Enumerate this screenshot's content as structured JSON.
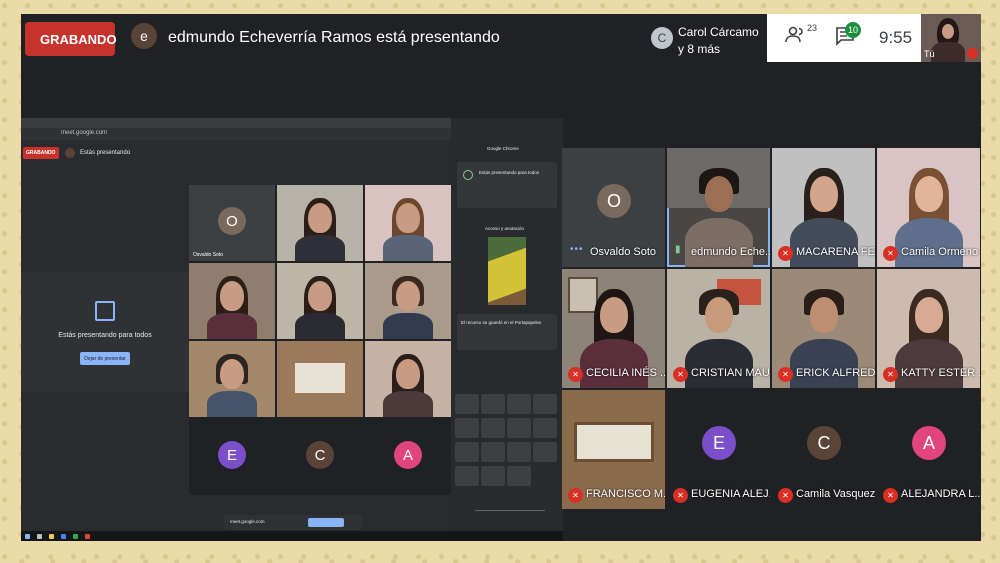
{
  "topbar": {
    "recording_label": "GRABANDO",
    "presenter_initial": "e",
    "presenter_text": "edmundo Echeverría Ramos está presentando",
    "people_summary_initial": "C",
    "people_summary_line1": "Carol Cárcamo",
    "people_summary_line2": "y 8 más",
    "participants_count": "23",
    "chat_count": "10",
    "clock": "9:55",
    "self_label": "Tú"
  },
  "shared_screen": {
    "recording_label": "GRABANDO",
    "presenting_label": "Estás presentando",
    "present_message": "Estás presentando para todos",
    "present_button": "Dejar de presentar",
    "mini_osvaldo": "Osvaldo Soto",
    "avatars": [
      {
        "initial": "E",
        "color": "#7b4fc9"
      },
      {
        "initial": "C",
        "color": "#5a4437"
      },
      {
        "initial": "A",
        "color": "#e0457b"
      }
    ],
    "mini_o_initial": "O",
    "side_panel_header": "Google Chrome",
    "side_panel_present": "Estás presentando para todos",
    "side_panel_caption": "Acceso y anotación",
    "side_panel_saved": "El recurso se guardó en el Portapapeles"
  },
  "participants": [
    {
      "name": "Osvaldo Soto",
      "initial": "O",
      "avatar_color": "#7a6a5e",
      "muted": false,
      "camera": false
    },
    {
      "name": "edmundo Eche...",
      "muted": false,
      "camera": true,
      "active": true
    },
    {
      "name": "MACARENA FE...",
      "muted": true,
      "camera": true
    },
    {
      "name": "Camila Ormeno",
      "muted": true,
      "camera": true
    },
    {
      "name": "CECILIA INÉS ...",
      "muted": true,
      "camera": true
    },
    {
      "name": "CRISTIAN MAU...",
      "muted": true,
      "camera": true
    },
    {
      "name": "ERICK ALFRED...",
      "muted": true,
      "camera": true
    },
    {
      "name": "KATTY ESTER ...",
      "muted": true,
      "camera": true
    },
    {
      "name": "FRANCISCO M...",
      "muted": true,
      "camera": true
    },
    {
      "name": "EUGENIA ALEJ...",
      "initial": "E",
      "avatar_color": "#7b4fc9",
      "muted": true,
      "camera": false
    },
    {
      "name": "Camila Vasquez",
      "initial": "C",
      "avatar_color": "#5a4437",
      "muted": true,
      "camera": false
    },
    {
      "name": "ALEJANDRA L...",
      "initial": "A",
      "avatar_color": "#e0457b",
      "muted": true,
      "camera": false
    }
  ],
  "colors": {
    "recording": "#c5332c",
    "muted": "#d93025",
    "chat_badge": "#1e8e3e",
    "accent": "#8ab4f8"
  }
}
